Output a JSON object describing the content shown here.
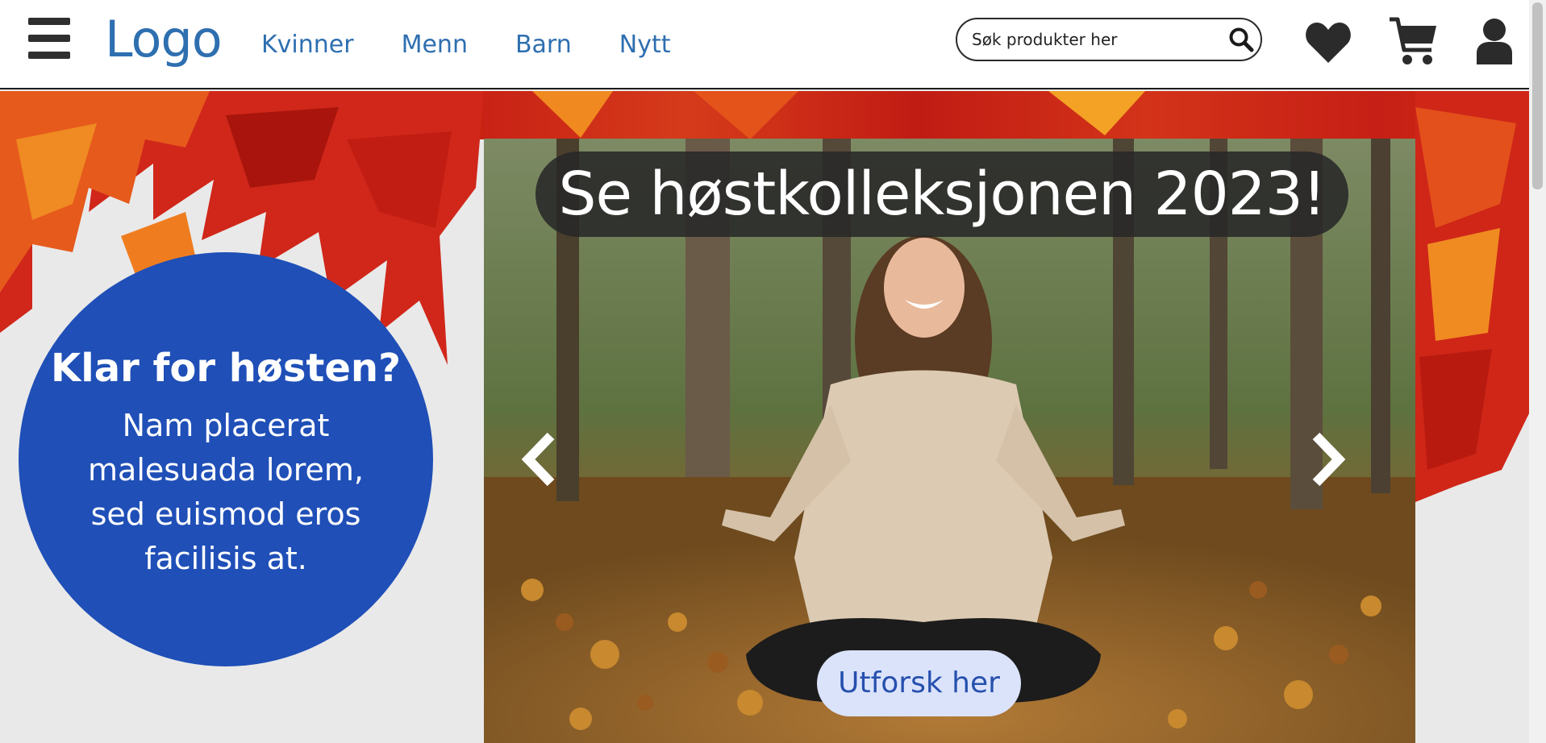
{
  "header": {
    "logo": "Logo",
    "nav": [
      "Kvinner",
      "Menn",
      "Barn",
      "Nytt"
    ],
    "search_placeholder": "Søk produkter her"
  },
  "promo": {
    "title": "Klar for høsten?",
    "body": "Nam placerat malesuada lorem, sed euismod eros facilisis at."
  },
  "carousel": {
    "title": "Se høstkolleksjonen 2023!",
    "cta_label": "Utforsk her"
  },
  "colors": {
    "brand_blue": "#2e6fb0",
    "promo_blue": "#1f4fb7",
    "cta_bg": "#dbe3fb",
    "cta_text": "#2650ad"
  },
  "icons": [
    "hamburger-menu-icon",
    "search-icon",
    "heart-icon",
    "cart-icon",
    "user-icon",
    "chevron-left-icon",
    "chevron-right-icon"
  ]
}
